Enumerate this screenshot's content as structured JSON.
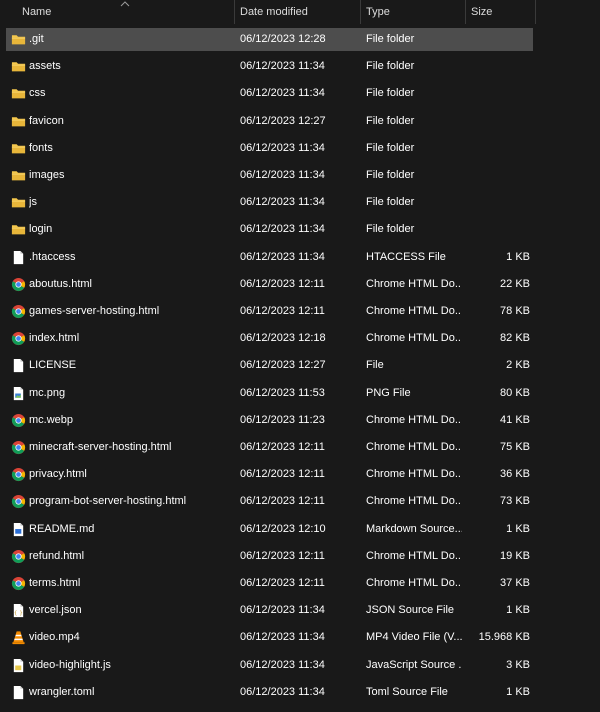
{
  "columns": {
    "name": "Name",
    "date": "Date modified",
    "type": "Type",
    "size": "Size"
  },
  "files": [
    {
      "name": ".git",
      "date": "06/12/2023 12:28",
      "type": "File folder",
      "size": "",
      "icon": "folder-icon"
    },
    {
      "name": "assets",
      "date": "06/12/2023 11:34",
      "type": "File folder",
      "size": "",
      "icon": "folder-icon"
    },
    {
      "name": "css",
      "date": "06/12/2023 11:34",
      "type": "File folder",
      "size": "",
      "icon": "folder-icon"
    },
    {
      "name": "favicon",
      "date": "06/12/2023 12:27",
      "type": "File folder",
      "size": "",
      "icon": "folder-icon"
    },
    {
      "name": "fonts",
      "date": "06/12/2023 11:34",
      "type": "File folder",
      "size": "",
      "icon": "folder-icon"
    },
    {
      "name": "images",
      "date": "06/12/2023 11:34",
      "type": "File folder",
      "size": "",
      "icon": "folder-icon"
    },
    {
      "name": "js",
      "date": "06/12/2023 11:34",
      "type": "File folder",
      "size": "",
      "icon": "folder-icon"
    },
    {
      "name": "login",
      "date": "06/12/2023 11:34",
      "type": "File folder",
      "size": "",
      "icon": "folder-icon"
    },
    {
      "name": ".htaccess",
      "date": "06/12/2023 11:34",
      "type": "HTACCESS File",
      "size": "1 KB",
      "icon": "file-icon"
    },
    {
      "name": "aboutus.html",
      "date": "06/12/2023 12:11",
      "type": "Chrome HTML Do...",
      "size": "22 KB",
      "icon": "chrome-icon"
    },
    {
      "name": "games-server-hosting.html",
      "date": "06/12/2023 12:11",
      "type": "Chrome HTML Do...",
      "size": "78 KB",
      "icon": "chrome-icon"
    },
    {
      "name": "index.html",
      "date": "06/12/2023 12:18",
      "type": "Chrome HTML Do...",
      "size": "82 KB",
      "icon": "chrome-icon"
    },
    {
      "name": "LICENSE",
      "date": "06/12/2023 12:27",
      "type": "File",
      "size": "2 KB",
      "icon": "file-icon"
    },
    {
      "name": "mc.png",
      "date": "06/12/2023 11:53",
      "type": "PNG File",
      "size": "80 KB",
      "icon": "image-file-icon"
    },
    {
      "name": "mc.webp",
      "date": "06/12/2023 11:23",
      "type": "Chrome HTML Do...",
      "size": "41 KB",
      "icon": "chrome-icon"
    },
    {
      "name": "minecraft-server-hosting.html",
      "date": "06/12/2023 12:11",
      "type": "Chrome HTML Do...",
      "size": "75 KB",
      "icon": "chrome-icon"
    },
    {
      "name": "privacy.html",
      "date": "06/12/2023 12:11",
      "type": "Chrome HTML Do...",
      "size": "36 KB",
      "icon": "chrome-icon"
    },
    {
      "name": "program-bot-server-hosting.html",
      "date": "06/12/2023 12:11",
      "type": "Chrome HTML Do...",
      "size": "73 KB",
      "icon": "chrome-icon"
    },
    {
      "name": "README.md",
      "date": "06/12/2023 12:10",
      "type": "Markdown Source...",
      "size": "1 KB",
      "icon": "markdown-file-icon"
    },
    {
      "name": "refund.html",
      "date": "06/12/2023 12:11",
      "type": "Chrome HTML Do...",
      "size": "19 KB",
      "icon": "chrome-icon"
    },
    {
      "name": "terms.html",
      "date": "06/12/2023 12:11",
      "type": "Chrome HTML Do...",
      "size": "37 KB",
      "icon": "chrome-icon"
    },
    {
      "name": "vercel.json",
      "date": "06/12/2023 11:34",
      "type": "JSON Source File",
      "size": "1 KB",
      "icon": "json-file-icon"
    },
    {
      "name": "video.mp4",
      "date": "06/12/2023 11:34",
      "type": "MP4 Video File (V...",
      "size": "15.968 KB",
      "icon": "vlc-icon"
    },
    {
      "name": "video-highlight.js",
      "date": "06/12/2023 11:34",
      "type": "JavaScript Source ...",
      "size": "3 KB",
      "icon": "js-file-icon"
    },
    {
      "name": "wrangler.toml",
      "date": "06/12/2023 11:34",
      "type": "Toml Source File",
      "size": "1 KB",
      "icon": "file-icon"
    }
  ],
  "selected_index": 0,
  "colors": {
    "background": "#191919",
    "selection": "#4d4d4d",
    "folder": "#f5c84c",
    "chrome_red": "#db4437",
    "chrome_green": "#0f9d58",
    "chrome_yellow": "#f4b400",
    "chrome_blue": "#4285f4",
    "vlc_orange": "#f48b00"
  }
}
